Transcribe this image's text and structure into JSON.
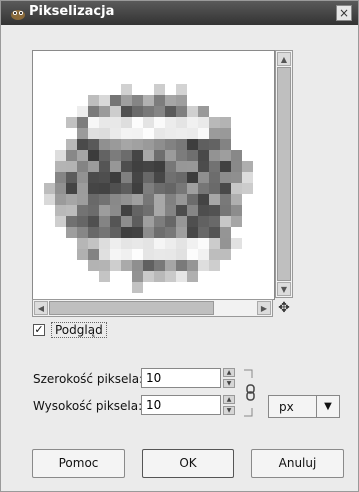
{
  "window": {
    "title": "Pikselizacja",
    "close_label": "×"
  },
  "preview": {
    "enabled_label": "Podgląd",
    "checked_mark": "✓"
  },
  "fields": {
    "width_label": "Szerokość piksela:",
    "width_value": "10",
    "height_label": "Wysokość piksela:",
    "height_value": "10"
  },
  "unit": {
    "selected": "px"
  },
  "buttons": {
    "help": "Pomoc",
    "ok": "OK",
    "cancel": "Anuluj"
  },
  "icons": {
    "title": "gimp-wilber-icon",
    "navigate": "navigate-move-icon",
    "chain": "chain-link-icon"
  }
}
